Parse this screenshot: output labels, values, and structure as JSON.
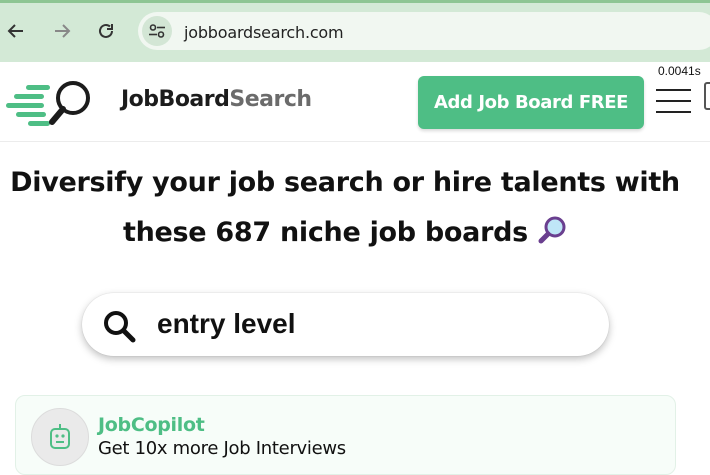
{
  "browser": {
    "url": "jobboardsearch.com"
  },
  "header": {
    "brand_part1": "JobBoard",
    "brand_part2": "Search",
    "add_button": "Add Job Board FREE",
    "timing": "0.0041s"
  },
  "hero": {
    "line1": "Diversify your job search or hire talents with",
    "line2": "these 687 niche job boards"
  },
  "search": {
    "value": "entry level"
  },
  "card": {
    "title": "JobCopilot",
    "subtitle": "Get 10x more Job Interviews"
  },
  "colors": {
    "accent": "#4ebe85",
    "chrome": "#d3e9d6"
  },
  "icons": [
    "back-arrow-icon",
    "forward-arrow-icon",
    "reload-icon",
    "site-settings-icon",
    "logo-magnifier-icon",
    "menu-icon",
    "search-icon",
    "magnifying-glass-emoji-icon",
    "robot-icon"
  ]
}
